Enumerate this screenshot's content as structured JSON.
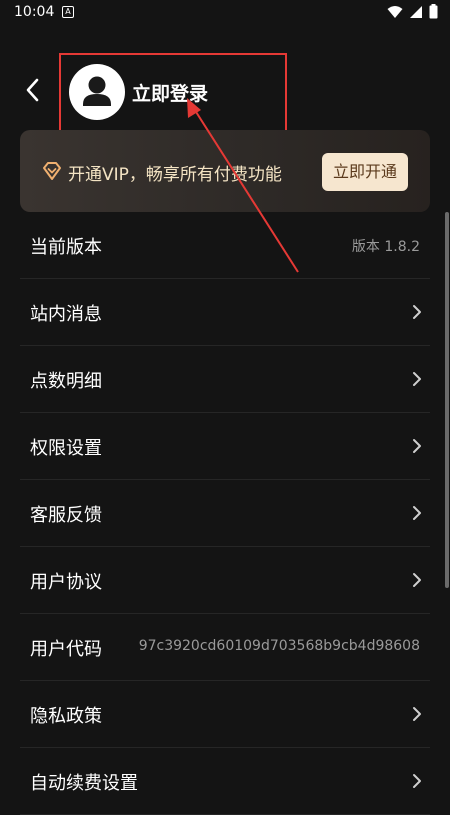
{
  "status_bar": {
    "time": "10:04",
    "notification_icon": "A"
  },
  "header": {
    "login_label": "立即登录"
  },
  "vip": {
    "text": "开通VIP，畅享所有付费功能",
    "button_label": "立即开通"
  },
  "settings": [
    {
      "label": "当前版本",
      "value": "版本 1.8.2",
      "chevron": false
    },
    {
      "label": "站内消息",
      "value": "",
      "chevron": true
    },
    {
      "label": "点数明细",
      "value": "",
      "chevron": true
    },
    {
      "label": "权限设置",
      "value": "",
      "chevron": true
    },
    {
      "label": "客服反馈",
      "value": "",
      "chevron": true
    },
    {
      "label": "用户协议",
      "value": "",
      "chevron": true
    },
    {
      "label": "用户代码",
      "value": "97c3920cd60109d703568b9cb4d98608",
      "chevron": false
    },
    {
      "label": "隐私政策",
      "value": "",
      "chevron": true
    },
    {
      "label": "自动续费设置",
      "value": "",
      "chevron": true
    }
  ],
  "colors": {
    "highlight": "#e53935",
    "vip_button_bg": "#f6e6cf",
    "vip_text": "#f4e4c4"
  }
}
